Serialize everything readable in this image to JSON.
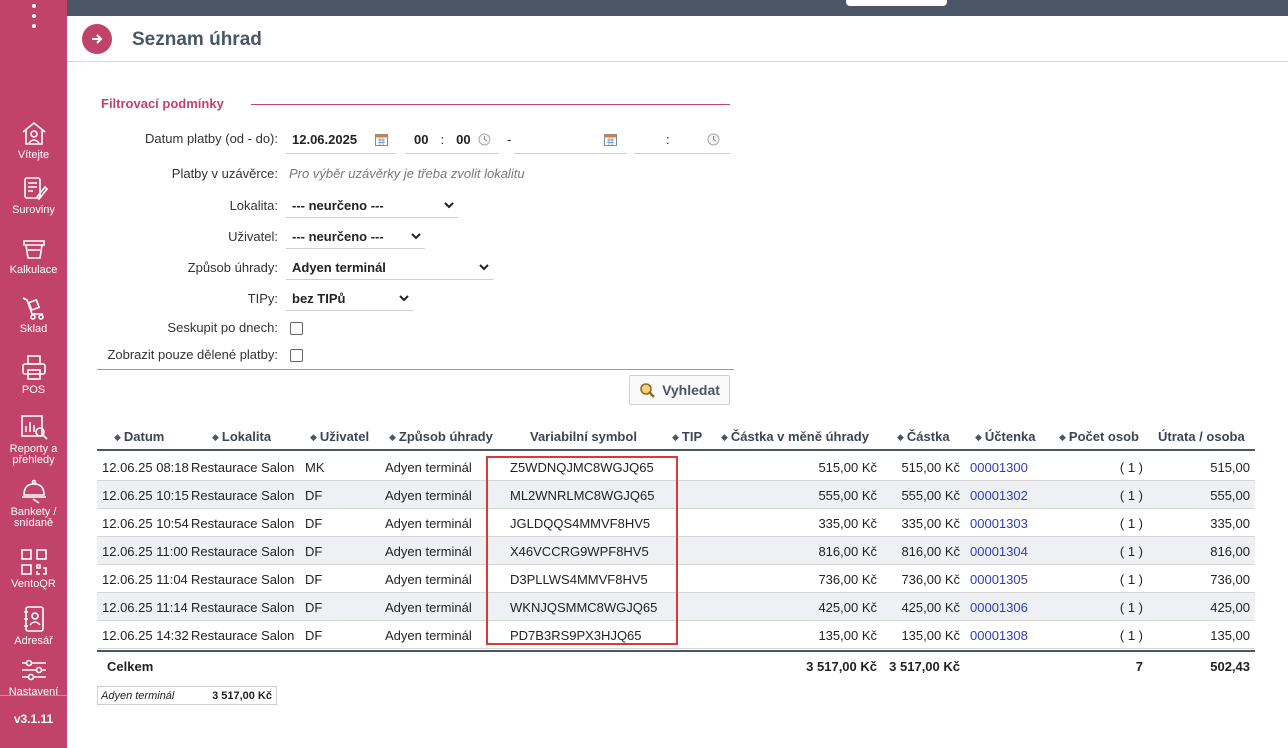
{
  "sidebar": {
    "items": [
      {
        "label": "Vítejte",
        "icon": "home-icon"
      },
      {
        "label": "Suroviny",
        "icon": "ingredients-icon"
      },
      {
        "label": "Kalkulace",
        "icon": "calculation-icon"
      },
      {
        "label": "Sklad",
        "icon": "warehouse-cart-icon"
      },
      {
        "label": "POS",
        "icon": "printer-icon"
      },
      {
        "label": "Reporty a přehledy",
        "icon": "reports-icon"
      },
      {
        "label": "Bankety / snídaně",
        "icon": "cloche-icon"
      },
      {
        "label": "VentoQR",
        "icon": "qr-code-icon"
      },
      {
        "label": "Adresář",
        "icon": "address-book-icon"
      },
      {
        "label": "Nastavení",
        "icon": "settings-sliders-icon"
      }
    ],
    "version": "v3.1.11"
  },
  "page": {
    "title": "Seznam úhrad"
  },
  "filter": {
    "heading": "Filtrovací podmínky",
    "date_label": "Datum platby (od - do):",
    "date_from": "12.06.2025",
    "time_from_h": "00",
    "time_from_m": "00",
    "time_sep": ":",
    "range_sep": "-",
    "date_to": "",
    "time_to_sep": ":",
    "closure_label": "Platby v uzávěrce:",
    "closure_hint": "Pro výběr uzávěrky je třeba zvolit lokalitu",
    "location_label": "Lokalita:",
    "location_value": "--- neurčeno ---",
    "user_label": "Uživatel:",
    "user_value": "--- neurčeno ---",
    "payment_label": "Způsob úhrady:",
    "payment_value": "Adyen terminál",
    "tips_label": "TIPy:",
    "tips_value": "bez TIPů",
    "group_label": "Seskupit po dnech:",
    "split_label": "Zobrazit pouze dělené platby:",
    "search_label": "Vyhledat"
  },
  "table": {
    "headers": {
      "date": "Datum",
      "location": "Lokalita",
      "user": "Uživatel",
      "method": "Způsob úhrady",
      "vs": "Variabilní symbol",
      "tip": "TIP",
      "amount_currency": "Částka v měně úhrady",
      "amount": "Částka",
      "receipt": "Účtenka",
      "persons": "Počet osob",
      "per_person": "Útrata / osoba"
    },
    "rows": [
      {
        "date": "12.06.25 08:18",
        "location": "Restaurace Salon",
        "user": "MK",
        "method": "Adyen terminál",
        "vs": "Z5WDNQJMC8WGJQ65",
        "amount_currency": "515,00 Kč",
        "amount": "515,00 Kč",
        "receipt": "00001300",
        "persons": "( 1 )",
        "per_person": "515,00"
      },
      {
        "date": "12.06.25 10:15",
        "location": "Restaurace Salon",
        "user": "DF",
        "method": "Adyen terminál",
        "vs": "ML2WNRLMC8WGJQ65",
        "amount_currency": "555,00 Kč",
        "amount": "555,00 Kč",
        "receipt": "00001302",
        "persons": "( 1 )",
        "per_person": "555,00"
      },
      {
        "date": "12.06.25 10:54",
        "location": "Restaurace Salon",
        "user": "DF",
        "method": "Adyen terminál",
        "vs": "JGLDQQS4MMVF8HV5",
        "amount_currency": "335,00 Kč",
        "amount": "335,00 Kč",
        "receipt": "00001303",
        "persons": "( 1 )",
        "per_person": "335,00"
      },
      {
        "date": "12.06.25 11:00",
        "location": "Restaurace Salon",
        "user": "DF",
        "method": "Adyen terminál",
        "vs": "X46VCCRG9WPF8HV5",
        "amount_currency": "816,00 Kč",
        "amount": "816,00 Kč",
        "receipt": "00001304",
        "persons": "( 1 )",
        "per_person": "816,00"
      },
      {
        "date": "12.06.25 11:04",
        "location": "Restaurace Salon",
        "user": "DF",
        "method": "Adyen terminál",
        "vs": "D3PLLWS4MMVF8HV5",
        "amount_currency": "736,00 Kč",
        "amount": "736,00 Kč",
        "receipt": "00001305",
        "persons": "( 1 )",
        "per_person": "736,00"
      },
      {
        "date": "12.06.25 11:14",
        "location": "Restaurace Salon",
        "user": "DF",
        "method": "Adyen terminál",
        "vs": "WKNJQSMMC8WGJQ65",
        "amount_currency": "425,00 Kč",
        "amount": "425,00 Kč",
        "receipt": "00001306",
        "persons": "( 1 )",
        "per_person": "425,00"
      },
      {
        "date": "12.06.25 14:32",
        "location": "Restaurace Salon",
        "user": "DF",
        "method": "Adyen terminál",
        "vs": "PD7B3RS9PX3HJQ65",
        "amount_currency": "135,00 Kč",
        "amount": "135,00 Kč",
        "receipt": "00001308",
        "persons": "( 1 )",
        "per_person": "135,00"
      }
    ],
    "total": {
      "label": "Celkem",
      "amount_currency": "3 517,00 Kč",
      "amount": "3 517,00 Kč",
      "persons": "7",
      "per_person": "502,43"
    }
  },
  "summary": {
    "method": "Adyen terminál",
    "amount": "3 517,00 Kč"
  },
  "colors": {
    "accent": "#c2436a",
    "topbar": "#4a5566",
    "link": "#2b3fb5",
    "highlight": "#d63a3a"
  }
}
